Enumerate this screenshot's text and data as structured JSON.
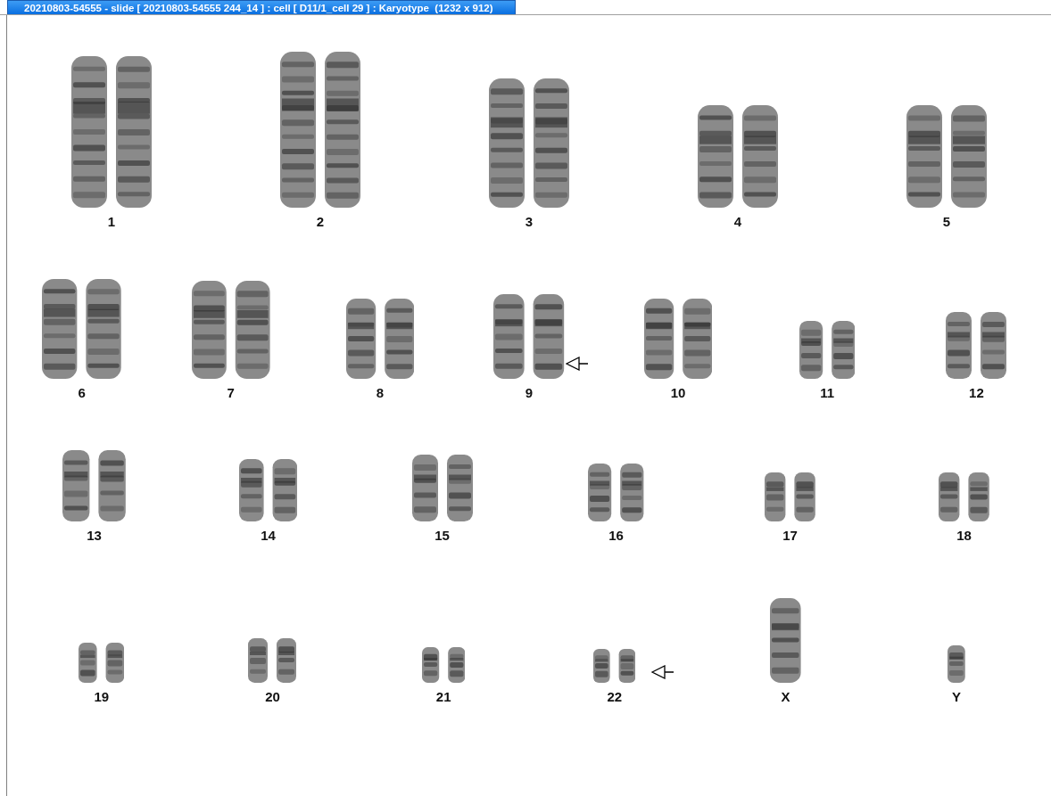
{
  "window": {
    "title": "20210803-54555 - slide [ 20210803-54555 244_14 ] : cell [ D11/1_cell 29 ] : Karyotype  (1232 x 912)"
  },
  "rows": [
    {
      "items": [
        {
          "label": "1",
          "kind": "pair",
          "flagged": false
        },
        {
          "label": "2",
          "kind": "pair",
          "flagged": false
        },
        {
          "label": "3",
          "kind": "pair",
          "flagged": false
        },
        {
          "label": "4",
          "kind": "pair",
          "flagged": false
        },
        {
          "label": "5",
          "kind": "pair",
          "flagged": false
        }
      ]
    },
    {
      "items": [
        {
          "label": "6",
          "kind": "pair",
          "flagged": false
        },
        {
          "label": "7",
          "kind": "pair",
          "flagged": false
        },
        {
          "label": "8",
          "kind": "pair",
          "flagged": false
        },
        {
          "label": "9",
          "kind": "pair",
          "flagged": true
        },
        {
          "label": "10",
          "kind": "pair",
          "flagged": false
        },
        {
          "label": "11",
          "kind": "pair",
          "flagged": false
        },
        {
          "label": "12",
          "kind": "pair",
          "flagged": false
        }
      ]
    },
    {
      "items": [
        {
          "label": "13",
          "kind": "pair",
          "flagged": false
        },
        {
          "label": "14",
          "kind": "pair",
          "flagged": false
        },
        {
          "label": "15",
          "kind": "pair",
          "flagged": false
        },
        {
          "label": "16",
          "kind": "pair",
          "flagged": false
        },
        {
          "label": "17",
          "kind": "pair",
          "flagged": false
        },
        {
          "label": "18",
          "kind": "pair",
          "flagged": false
        }
      ]
    },
    {
      "items": [
        {
          "label": "19",
          "kind": "pair",
          "flagged": false
        },
        {
          "label": "20",
          "kind": "pair",
          "flagged": false
        },
        {
          "label": "21",
          "kind": "pair",
          "flagged": false
        },
        {
          "label": "22",
          "kind": "pair",
          "flagged": true
        },
        {
          "label": "X",
          "kind": "single",
          "flagged": false
        },
        {
          "label": "Y",
          "kind": "single",
          "flagged": false
        }
      ]
    }
  ]
}
